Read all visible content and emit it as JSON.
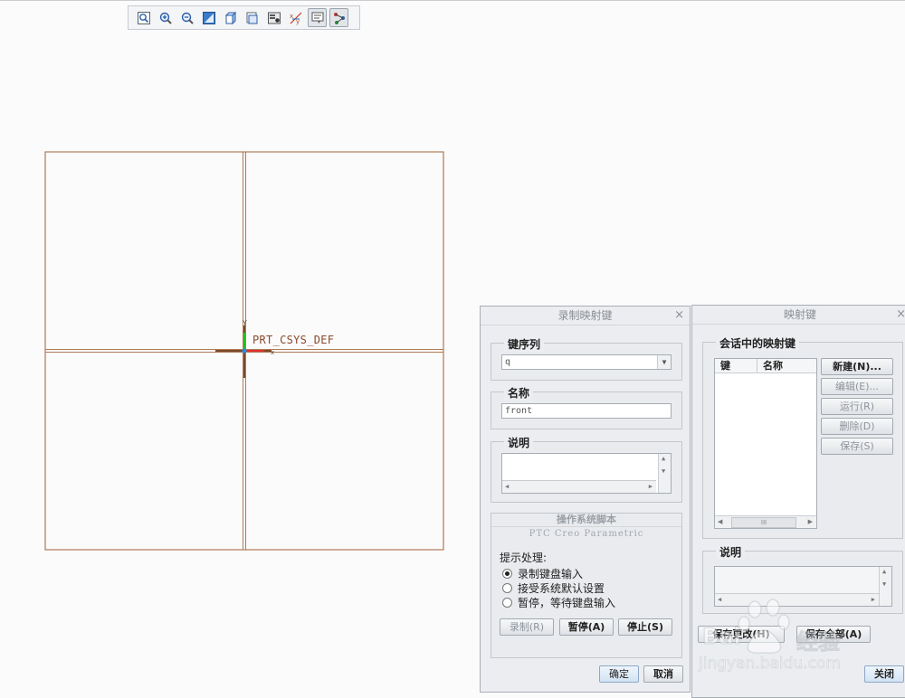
{
  "toolbar": {
    "buttons": [
      {
        "icon": "refit-icon"
      },
      {
        "icon": "zoom-in-icon"
      },
      {
        "icon": "zoom-out-icon"
      },
      {
        "icon": "repaint-icon"
      },
      {
        "icon": "display-style-icon"
      },
      {
        "icon": "saved-orientations-icon"
      },
      {
        "icon": "view-manager-icon"
      },
      {
        "icon": "datum-display-icon"
      },
      {
        "icon": "annotation-display-icon"
      },
      {
        "icon": "spin-center-icon"
      }
    ]
  },
  "model": {
    "csys_label": "PRT_CSYS_DEF",
    "colors": {
      "frame": "#b07a55",
      "axis_x": "#e03030",
      "axis_y": "#20c020",
      "axis_z": "#2090e0"
    }
  },
  "record_dialog": {
    "title": "录制映射键",
    "close": "×",
    "key_sequence": {
      "label": "键序列",
      "value": "q"
    },
    "name": {
      "label": "名称",
      "value": "front"
    },
    "description": {
      "label": "说明"
    },
    "os_script": {
      "tab_label": "操作系统脚本",
      "subtitle": "PTC Creo Parametric"
    },
    "prompt": {
      "label": "提示处理:",
      "options": [
        {
          "label": "录制键盘输入",
          "selected": true
        },
        {
          "label": "接受系统默认设置",
          "selected": false
        },
        {
          "label": "暂停，等待键盘输入",
          "selected": false
        }
      ]
    },
    "buttons": {
      "record": "录制(R)",
      "pause": "暂停(A)",
      "stop": "停止(S)"
    },
    "footer": {
      "ok": "确定",
      "cancel": "取消"
    }
  },
  "mapkeys_dialog": {
    "title": "映射键",
    "close": "×",
    "session_group": {
      "label": "会话中的映射键",
      "columns": [
        "键",
        "名称"
      ],
      "scroll_text": "III"
    },
    "side_buttons": {
      "new": "新建(N)...",
      "edit": "编辑(E)...",
      "run": "运行(R)",
      "delete": "删除(D)",
      "save": "保存(S)"
    },
    "description": {
      "label": "说明"
    },
    "bottom_buttons": {
      "save_changed": "保存更改(H)",
      "save_all": "保存全部(A)"
    },
    "footer": {
      "close": "关闭"
    }
  },
  "watermark": {
    "brand": "Bai",
    "brand2": "经验",
    "url": "jingyan.baidu.com"
  }
}
